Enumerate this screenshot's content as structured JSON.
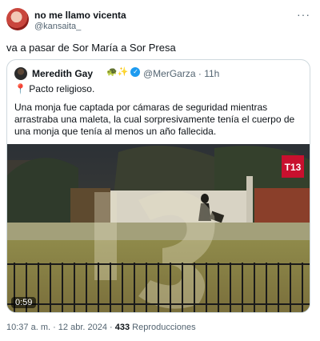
{
  "author": {
    "display_name": "no me llamo vicenta",
    "handle": "@kansaita_"
  },
  "more_label": "···",
  "tweet_text": "va a pasar de Sor María a Sor Presa",
  "quoted": {
    "display_name": "Meredith Gay",
    "badges": "🐢✨",
    "handle_time": "@MerGarza · 11h",
    "line1": "📍 Pacto religioso.",
    "body": "Una monja fue captada por cámaras de seguridad mientras arrastraba una maleta, la cual sorpresivamente tenía el cuerpo de una monja que tenía al menos un año fallecida.",
    "video": {
      "duration": "0:59",
      "watermark": "T13"
    }
  },
  "footer": {
    "timestamp": "10:37 a. m. · 12 abr. 2024 · ",
    "views_count": "433",
    "views_label": " Reproducciones"
  }
}
